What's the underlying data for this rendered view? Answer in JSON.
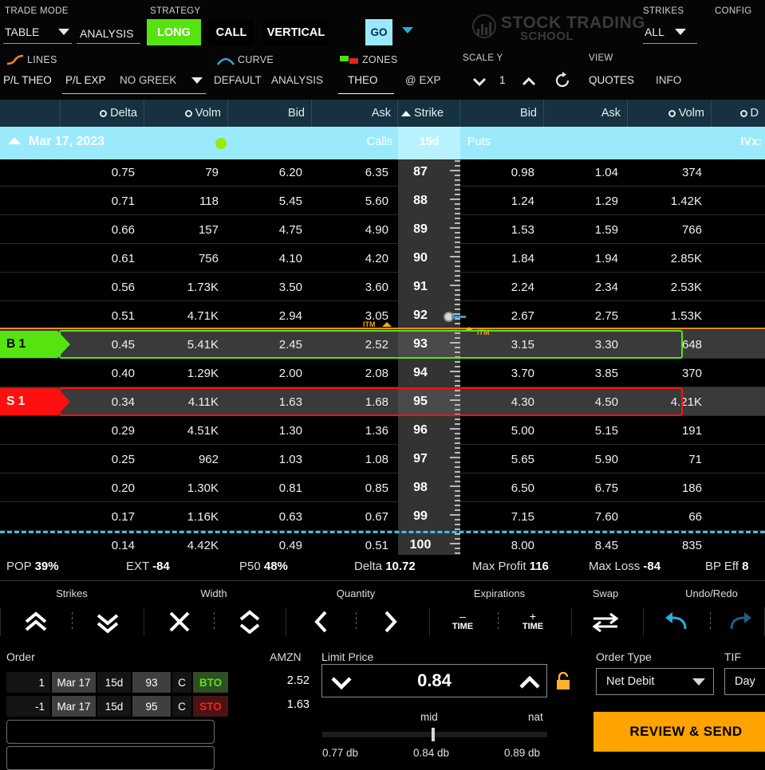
{
  "toolbar": {
    "trade_mode_label": "TRADE MODE",
    "trade_mode_value": "TABLE",
    "analysis_label": "ANALYSIS",
    "strategy_label": "STRATEGY",
    "strategy_direction": "LONG",
    "strategy_type": "CALL",
    "strategy_spread": "VERTICAL",
    "go_label": "GO",
    "strikes_label": "STRIKES",
    "strikes_value": "ALL",
    "config_label": "CONFIG",
    "logo_line1": "STOCK TRADING",
    "logo_line2": "SCHOOL",
    "lines_label": "LINES",
    "curve_label": "CURVE",
    "zones_label": "ZONES",
    "scale_y_label": "SCALE Y",
    "scale_y_value": "1",
    "view_label": "VIEW",
    "pl_theo_label": "P/L THEO",
    "pl_exp_label": "P/L EXP",
    "greek_value": "NO GREEK",
    "default_label": "DEFAULT",
    "analysis2_label": "ANALYSIS",
    "theo_label": "THEO",
    "at_exp_label": "@ EXP",
    "quotes_label": "QUOTES",
    "info_label": "INFO"
  },
  "columns": {
    "delta": "Delta",
    "volm": "Volm",
    "bid": "Bid",
    "ask": "Ask",
    "strike": "Strike",
    "put_bid": "Bid",
    "put_ask": "Ask",
    "put_volm": "Volm",
    "put_delta": "D"
  },
  "expiry": {
    "date": "Mar 17, 2023",
    "calls": "Calls",
    "dte": "15d",
    "puts": "Puts",
    "ivx": "IVx:"
  },
  "chain": [
    {
      "delta": "0.75",
      "volm": "79",
      "bid": "6.20",
      "ask": "6.35",
      "strike": "87",
      "pbid": "0.98",
      "pask": "1.04",
      "pvolm": "374",
      "mark": ""
    },
    {
      "delta": "0.71",
      "volm": "118",
      "bid": "5.45",
      "ask": "5.60",
      "strike": "88",
      "pbid": "1.24",
      "pask": "1.29",
      "pvolm": "1.42K",
      "mark": ""
    },
    {
      "delta": "0.66",
      "volm": "157",
      "bid": "4.75",
      "ask": "4.90",
      "strike": "89",
      "pbid": "1.53",
      "pask": "1.59",
      "pvolm": "766",
      "mark": ""
    },
    {
      "delta": "0.61",
      "volm": "756",
      "bid": "4.10",
      "ask": "4.20",
      "strike": "90",
      "pbid": "1.84",
      "pask": "1.94",
      "pvolm": "2.85K",
      "mark": ""
    },
    {
      "delta": "0.56",
      "volm": "1.73K",
      "bid": "3.50",
      "ask": "3.60",
      "strike": "91",
      "pbid": "2.24",
      "pask": "2.34",
      "pvolm": "2.53K",
      "mark": ""
    },
    {
      "delta": "0.51",
      "volm": "4.71K",
      "bid": "2.94",
      "ask": "3.05",
      "strike": "92",
      "pbid": "2.67",
      "pask": "2.75",
      "pvolm": "1.53K",
      "mark": ""
    },
    {
      "delta": "0.45",
      "volm": "5.41K",
      "bid": "2.45",
      "ask": "2.52",
      "strike": "93",
      "pbid": "3.15",
      "pask": "3.30",
      "pvolm": "648",
      "mark": "B 1"
    },
    {
      "delta": "0.40",
      "volm": "1.29K",
      "bid": "2.00",
      "ask": "2.08",
      "strike": "94",
      "pbid": "3.70",
      "pask": "3.85",
      "pvolm": "370",
      "mark": ""
    },
    {
      "delta": "0.34",
      "volm": "4.11K",
      "bid": "1.63",
      "ask": "1.68",
      "strike": "95",
      "pbid": "4.30",
      "pask": "4.50",
      "pvolm": "4.21K",
      "mark": "S 1"
    },
    {
      "delta": "0.29",
      "volm": "4.51K",
      "bid": "1.30",
      "ask": "1.36",
      "strike": "96",
      "pbid": "5.00",
      "pask": "5.15",
      "pvolm": "191",
      "mark": ""
    },
    {
      "delta": "0.25",
      "volm": "962",
      "bid": "1.03",
      "ask": "1.08",
      "strike": "97",
      "pbid": "5.65",
      "pask": "5.90",
      "pvolm": "71",
      "mark": ""
    },
    {
      "delta": "0.20",
      "volm": "1.30K",
      "bid": "0.81",
      "ask": "0.85",
      "strike": "98",
      "pbid": "6.50",
      "pask": "6.75",
      "pvolm": "186",
      "mark": ""
    },
    {
      "delta": "0.17",
      "volm": "1.16K",
      "bid": "0.63",
      "ask": "0.67",
      "strike": "99",
      "pbid": "7.15",
      "pask": "7.60",
      "pvolm": "66",
      "mark": ""
    },
    {
      "delta": "0.14",
      "volm": "4.42K",
      "bid": "0.49",
      "ask": "0.51",
      "strike": "100",
      "pbid": "8.00",
      "pask": "8.45",
      "pvolm": "835",
      "mark": ""
    }
  ],
  "itm_label": "ITM",
  "stats": [
    {
      "label": "POP",
      "value": "39%"
    },
    {
      "label": "EXT",
      "value": "-84"
    },
    {
      "label": "P50",
      "value": "48%"
    },
    {
      "label": "Delta",
      "value": "10.72"
    },
    {
      "label": "Max Profit",
      "value": "116"
    },
    {
      "label": "Max Loss",
      "value": "-84"
    },
    {
      "label": "BP Eff",
      "value": "8"
    }
  ],
  "actions": {
    "strikes": "Strikes",
    "width": "Width",
    "quantity": "Quantity",
    "expirations": "Expirations",
    "swap": "Swap",
    "undo_redo": "Undo/Redo",
    "minus_time": "TIME",
    "plus_time": "TIME",
    "minus_sign": "–",
    "plus_sign": "+"
  },
  "order": {
    "title": "Order",
    "symbol": "AMZN",
    "legs": [
      {
        "qty": "1",
        "exp": "Mar 17",
        "dte": "15d",
        "strike": "93",
        "type": "C",
        "action": "BTO",
        "price": "2.52"
      },
      {
        "qty": "-1",
        "exp": "Mar 17",
        "dte": "15d",
        "strike": "95",
        "type": "C",
        "action": "STO",
        "price": "1.63"
      }
    ],
    "limit_price_label": "Limit Price",
    "limit_price": "0.84",
    "slider": {
      "mid_label": "mid",
      "nat_label": "nat",
      "low": "0.77 db",
      "mid": "0.84 db",
      "high": "0.89 db"
    },
    "order_type_label": "Order Type",
    "order_type_value": "Net Debit",
    "tif_label": "TIF",
    "tif_value": "Day",
    "review_label": "REVIEW & SEND"
  },
  "colors": {
    "accent_green": "#55e410",
    "accent_red": "#ff0f0f",
    "accent_cyan": "#9beafc",
    "accent_orange": "#ffa300",
    "itm_orange": "#f3a51b"
  }
}
